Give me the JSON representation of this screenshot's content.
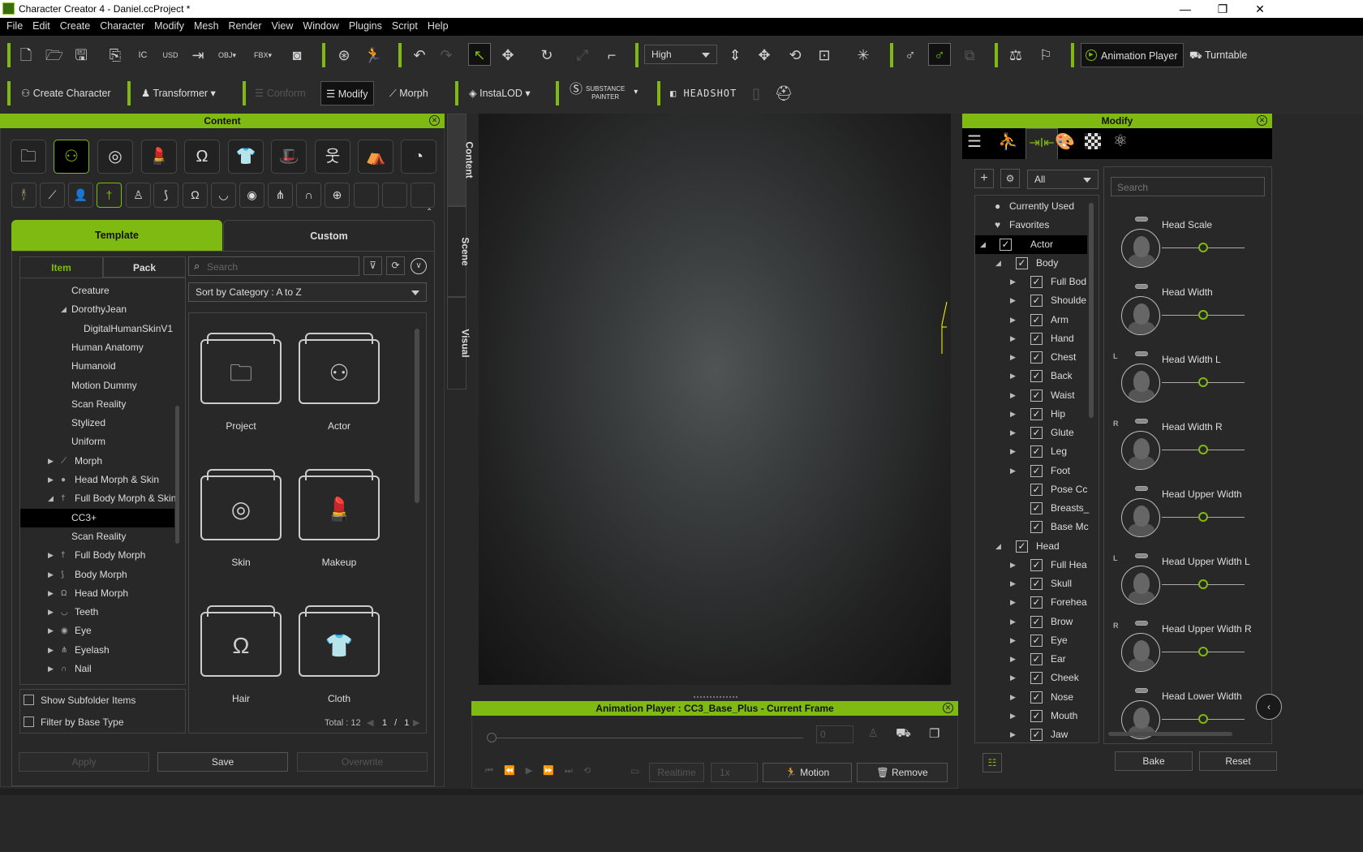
{
  "window": {
    "title": "Character Creator 4 - Daniel.ccProject *",
    "minimize": "—",
    "maximize": "❐",
    "close": "✕"
  },
  "menu": [
    "File",
    "Edit",
    "Create",
    "Character",
    "Modify",
    "Mesh",
    "Render",
    "View",
    "Window",
    "Plugins",
    "Script",
    "Help"
  ],
  "toolbar": {
    "quality_select": "High",
    "animation_player_label": "Animation Player",
    "turntable_label": "Turntable"
  },
  "toolbar2": {
    "create_character": "Create Character",
    "transformer": "Transformer",
    "conform": "Conform",
    "modify": "Modify",
    "morph": "Morph",
    "instalod": "InstaLOD",
    "substance_line1": "SUBSTANCE",
    "substance_line2": "PAINTER",
    "headshot": "HEADSHOT"
  },
  "content_panel": {
    "title": "Content",
    "tabs": {
      "template": "Template",
      "custom": "Custom"
    },
    "subtabs": {
      "item": "Item",
      "pack": "Pack"
    },
    "search_placeholder": "Search",
    "sort": "Sort by Category : A to Z",
    "tree": [
      {
        "label": "Creature",
        "indent": 2,
        "arrow": ""
      },
      {
        "label": "DorothyJean",
        "indent": 2,
        "arrow": "down"
      },
      {
        "label": "DigitalHumanSkinV1",
        "indent": 3,
        "arrow": ""
      },
      {
        "label": "Human Anatomy",
        "indent": 2,
        "arrow": ""
      },
      {
        "label": "Humanoid",
        "indent": 2,
        "arrow": ""
      },
      {
        "label": "Motion Dummy",
        "indent": 2,
        "arrow": ""
      },
      {
        "label": "Scan Reality",
        "indent": 2,
        "arrow": ""
      },
      {
        "label": "Stylized",
        "indent": 2,
        "arrow": ""
      },
      {
        "label": "Uniform",
        "indent": 2,
        "arrow": ""
      },
      {
        "label": "Morph",
        "indent": 1,
        "arrow": "right",
        "icon": "⟋"
      },
      {
        "label": "Head Morph & Skin",
        "indent": 1,
        "arrow": "right",
        "icon": "●"
      },
      {
        "label": "Full Body Morph & Skin",
        "indent": 1,
        "arrow": "down",
        "icon": "†"
      },
      {
        "label": "CC3+",
        "indent": 2,
        "arrow": "",
        "selected": true
      },
      {
        "label": "Scan Reality",
        "indent": 2,
        "arrow": ""
      },
      {
        "label": "Full Body Morph",
        "indent": 1,
        "arrow": "right",
        "icon": "†"
      },
      {
        "label": "Body Morph",
        "indent": 1,
        "arrow": "right",
        "icon": "⟆"
      },
      {
        "label": "Head Morph",
        "indent": 1,
        "arrow": "right",
        "icon": "Ω"
      },
      {
        "label": "Teeth",
        "indent": 1,
        "arrow": "right",
        "icon": "◡"
      },
      {
        "label": "Eye",
        "indent": 1,
        "arrow": "right",
        "icon": "◉"
      },
      {
        "label": "Eyelash",
        "indent": 1,
        "arrow": "right",
        "icon": "⋔"
      },
      {
        "label": "Nail",
        "indent": 1,
        "arrow": "right",
        "icon": "∩"
      }
    ],
    "folders": [
      {
        "label": "Project",
        "icon": "🗀"
      },
      {
        "label": "Actor",
        "icon": "⚇"
      },
      {
        "label": "Skin",
        "icon": "◎"
      },
      {
        "label": "Makeup",
        "icon": "💄"
      },
      {
        "label": "Hair",
        "icon": "Ω"
      },
      {
        "label": "Cloth",
        "icon": "👕"
      }
    ],
    "show_subfolder": "Show Subfolder Items",
    "filter_base": "Filter by Base Type",
    "total": "Total : 12",
    "page": "1 / 1",
    "apply": "Apply",
    "save": "Save",
    "overwrite": "Overwrite",
    "side_tabs": [
      "Content",
      "Scene",
      "Visual"
    ]
  },
  "animation_player": {
    "title": "Animation Player : CC3_Base_Plus - Current Frame",
    "frame": "0",
    "realtime": "Realtime",
    "speed": "1x",
    "motion": "Motion",
    "remove": "Remove"
  },
  "modify_panel": {
    "title": "Modify",
    "filter": "All",
    "search_placeholder": "Search",
    "tree": [
      {
        "label": "Currently Used",
        "lvl": 0,
        "icon": "●"
      },
      {
        "label": "Favorites",
        "lvl": 0,
        "icon": "♥"
      },
      {
        "label": "Actor",
        "lvl": 0,
        "check": true,
        "arrow": "down",
        "selected": true
      },
      {
        "label": "Body",
        "lvl": 1,
        "check": true,
        "arrow": "down"
      },
      {
        "label": "Full Bod",
        "lvl": 2,
        "check": true,
        "arrow": "right"
      },
      {
        "label": "Shoulde",
        "lvl": 2,
        "check": true,
        "arrow": "right"
      },
      {
        "label": "Arm",
        "lvl": 2,
        "check": true,
        "arrow": "right"
      },
      {
        "label": "Hand",
        "lvl": 2,
        "check": true,
        "arrow": "right"
      },
      {
        "label": "Chest",
        "lvl": 2,
        "check": true,
        "arrow": "right"
      },
      {
        "label": "Back",
        "lvl": 2,
        "check": true,
        "arrow": "right"
      },
      {
        "label": "Waist",
        "lvl": 2,
        "check": true,
        "arrow": "right"
      },
      {
        "label": "Hip",
        "lvl": 2,
        "check": true,
        "arrow": "right"
      },
      {
        "label": "Glute",
        "lvl": 2,
        "check": true,
        "arrow": "right"
      },
      {
        "label": "Leg",
        "lvl": 2,
        "check": true,
        "arrow": "right"
      },
      {
        "label": "Foot",
        "lvl": 2,
        "check": true,
        "arrow": "right"
      },
      {
        "label": "Pose Cc",
        "lvl": 2,
        "check": true,
        "arrow": ""
      },
      {
        "label": "Breasts_",
        "lvl": 2,
        "check": true,
        "arrow": ""
      },
      {
        "label": "Base Mc",
        "lvl": 2,
        "check": true,
        "arrow": ""
      },
      {
        "label": "Head",
        "lvl": 1,
        "check": true,
        "arrow": "down"
      },
      {
        "label": "Full Hea",
        "lvl": 2,
        "check": true,
        "arrow": "right"
      },
      {
        "label": "Skull",
        "lvl": 2,
        "check": true,
        "arrow": "right"
      },
      {
        "label": "Forehea",
        "lvl": 2,
        "check": true,
        "arrow": "right"
      },
      {
        "label": "Brow",
        "lvl": 2,
        "check": true,
        "arrow": "right"
      },
      {
        "label": "Eye",
        "lvl": 2,
        "check": true,
        "arrow": "right"
      },
      {
        "label": "Ear",
        "lvl": 2,
        "check": true,
        "arrow": "right"
      },
      {
        "label": "Cheek",
        "lvl": 2,
        "check": true,
        "arrow": "right"
      },
      {
        "label": "Nose",
        "lvl": 2,
        "check": true,
        "arrow": "right"
      },
      {
        "label": "Mouth",
        "lvl": 2,
        "check": true,
        "arrow": "right"
      },
      {
        "label": "Jaw",
        "lvl": 2,
        "check": true,
        "arrow": "right"
      }
    ],
    "sliders": [
      {
        "label": "Head Scale",
        "side": "",
        "value": 0.5
      },
      {
        "label": "Head Width",
        "side": "",
        "value": 0.5
      },
      {
        "label": "Head Width L",
        "side": "L",
        "value": 0.5
      },
      {
        "label": "Head Width R",
        "side": "R",
        "value": 0.5
      },
      {
        "label": "Head Upper Width",
        "side": "",
        "value": 0.5
      },
      {
        "label": "Head Upper Width L",
        "side": "L",
        "value": 0.5
      },
      {
        "label": "Head Upper Width R",
        "side": "R",
        "value": 0.5
      },
      {
        "label": "Head Lower Width",
        "side": "",
        "value": 0.5
      }
    ],
    "bake": "Bake",
    "reset": "Reset"
  }
}
